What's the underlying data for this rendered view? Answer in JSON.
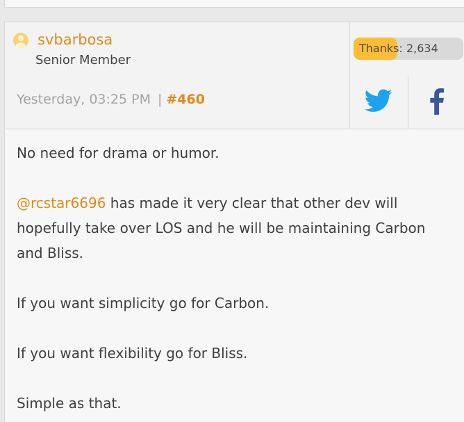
{
  "post": {
    "username": "svbarbosa",
    "user_title": "Senior Member",
    "timestamp": "Yesterday, 03:25 PM",
    "separator": "|",
    "post_number": "#460",
    "thanks_label": "Thanks: 2,634",
    "thanks_progress_percent": 40,
    "share_icons": [
      "twitter-icon",
      "facebook-icon"
    ],
    "accent_color": "#e08a1b",
    "twitter_color": "#1da1f2",
    "facebook_color": "#3b5998"
  },
  "body": {
    "line1": "No need for drama or humor.",
    "mention": "@rcstar6696",
    "line2_rest": " has made it very clear that other dev will hopefully take over LOS and he will be maintaining Carbon and Bliss.",
    "line3": "If you want simplicity go for Carbon.",
    "line4": "If you want flexibility go for Bliss.",
    "line5": "Simple as that."
  }
}
